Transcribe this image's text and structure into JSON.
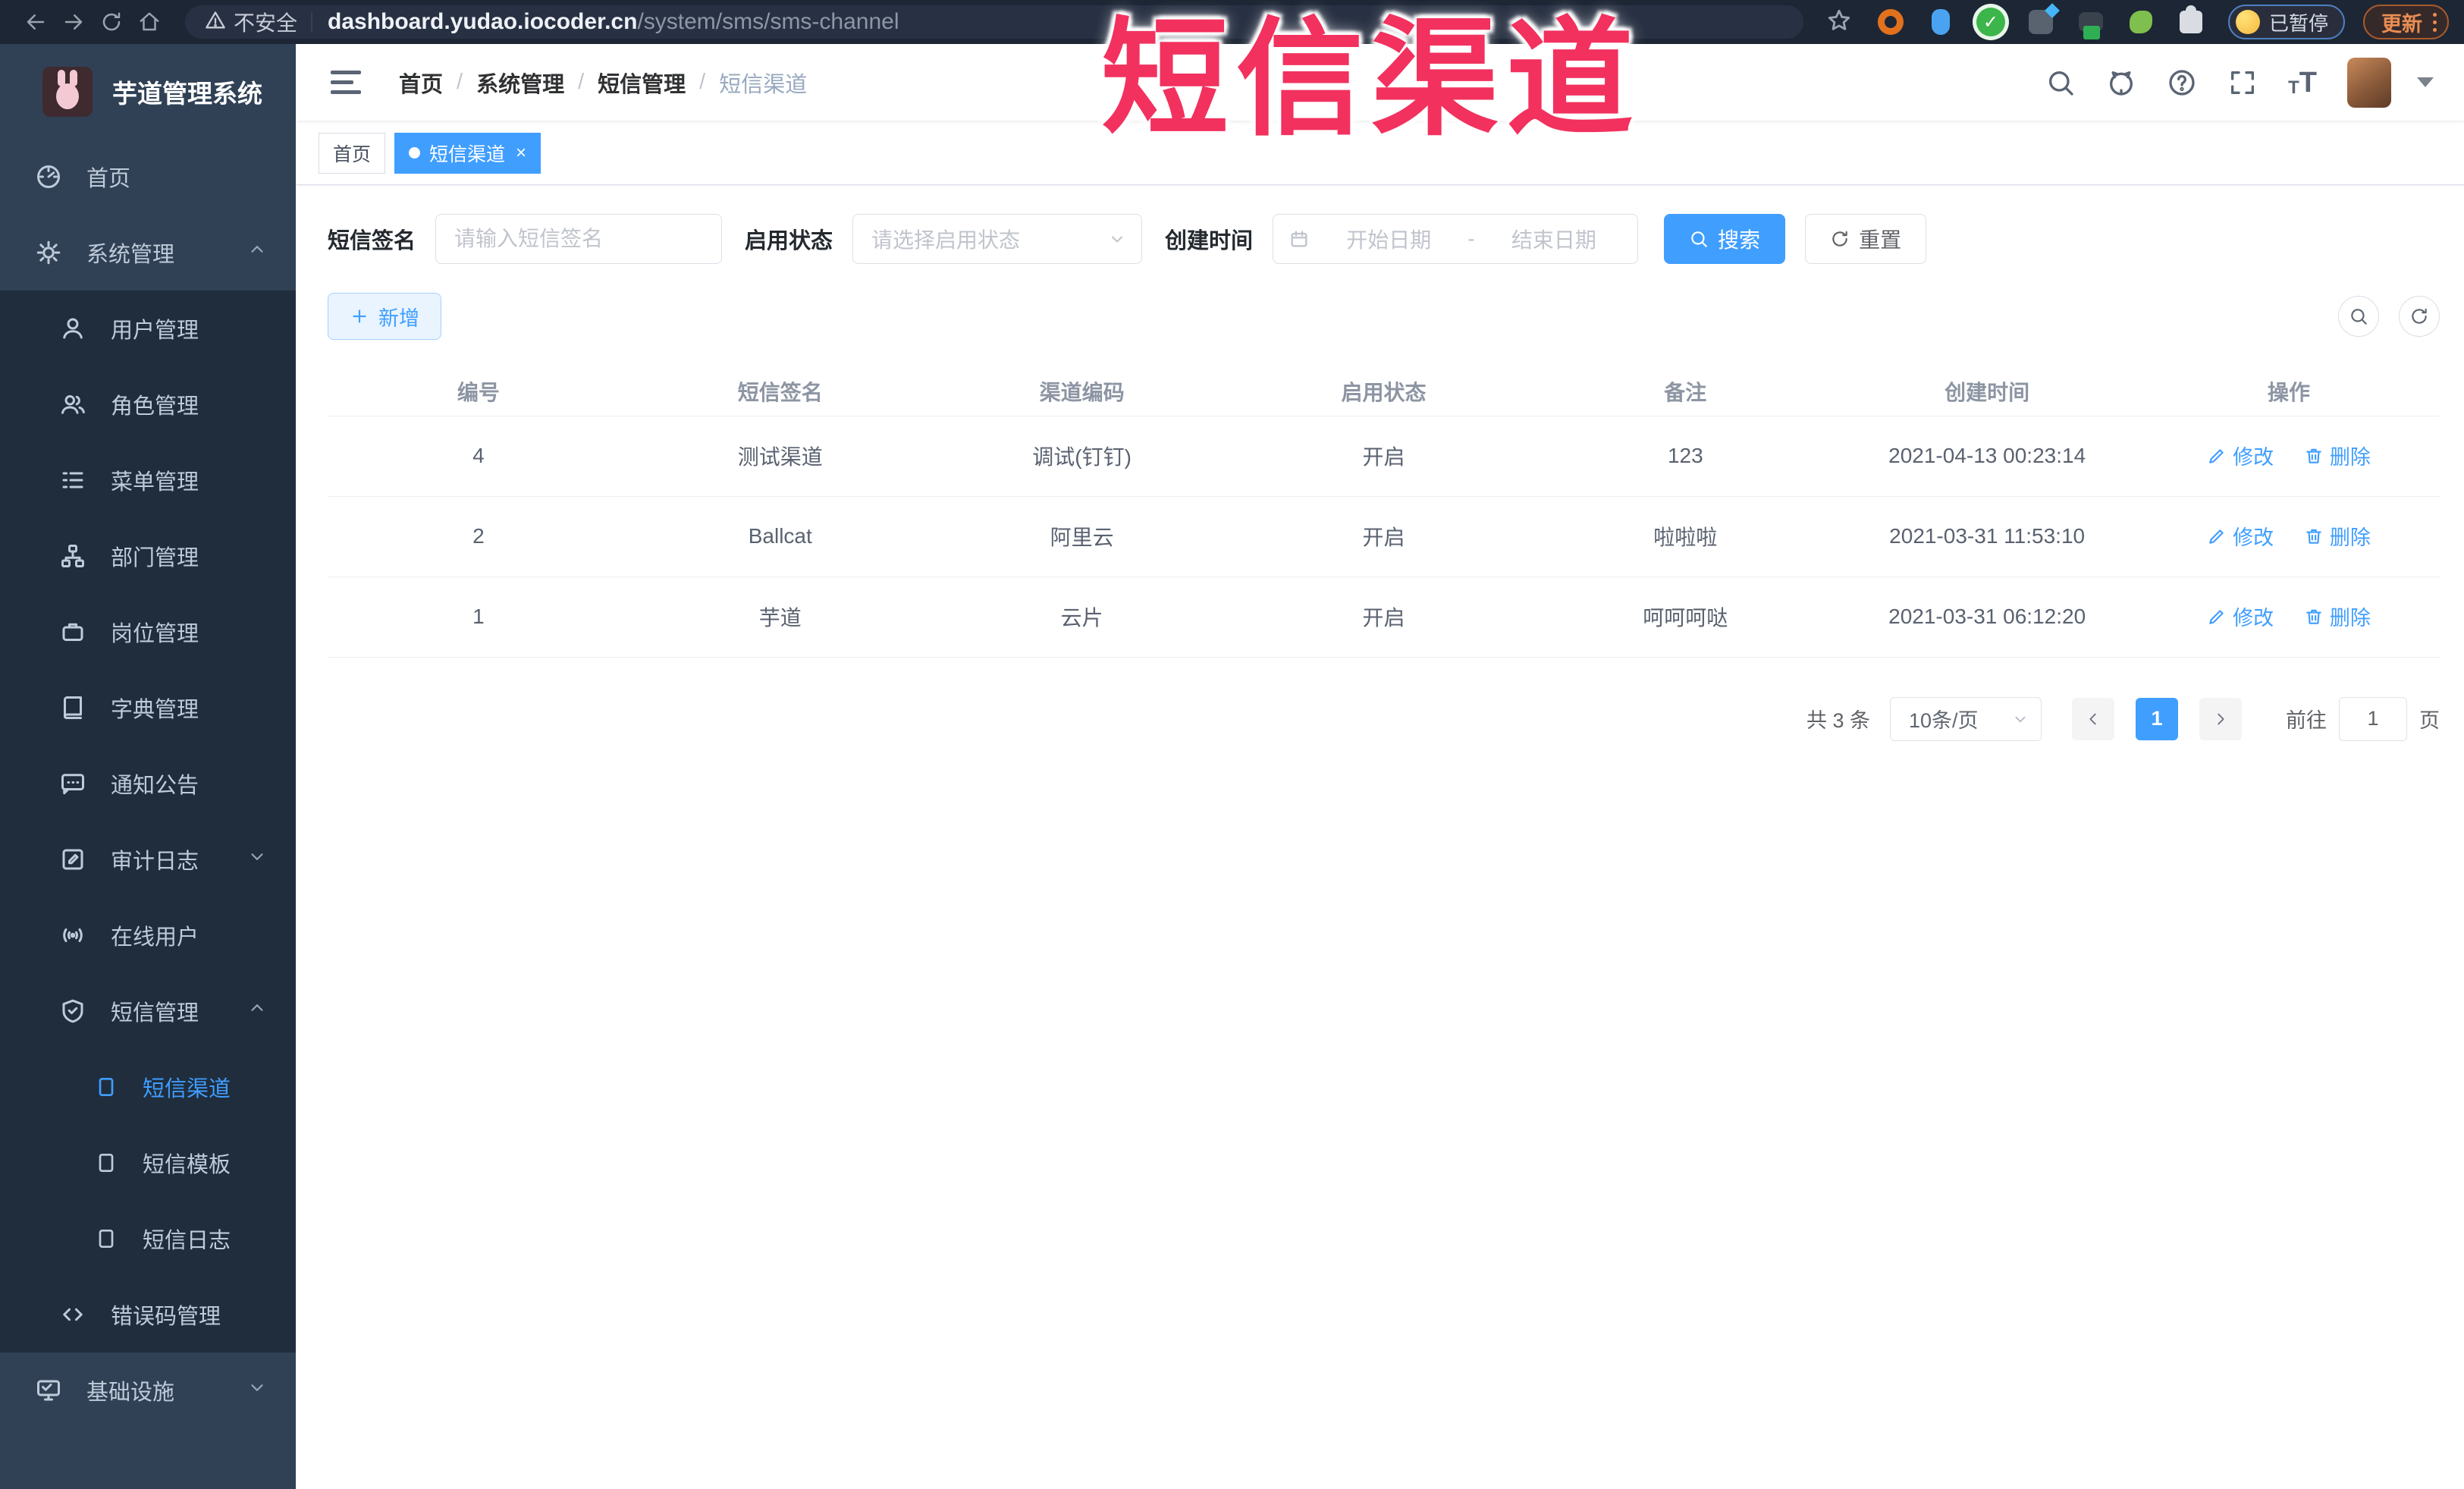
{
  "browser": {
    "security_label": "不安全",
    "url_host": "dashboard.yudao.iocoder.cn",
    "url_path": "/system/sms/sms-channel",
    "paused_badge": "已暂停",
    "update_button": "更新"
  },
  "annotation": {
    "text": "短信渠道"
  },
  "sidebar": {
    "logo_title": "芋道管理系统",
    "items": [
      {
        "label": "首页"
      },
      {
        "label": "系统管理"
      },
      {
        "label": "用户管理"
      },
      {
        "label": "角色管理"
      },
      {
        "label": "菜单管理"
      },
      {
        "label": "部门管理"
      },
      {
        "label": "岗位管理"
      },
      {
        "label": "字典管理"
      },
      {
        "label": "通知公告"
      },
      {
        "label": "审计日志"
      },
      {
        "label": "在线用户"
      },
      {
        "label": "短信管理"
      },
      {
        "label": "短信渠道"
      },
      {
        "label": "短信模板"
      },
      {
        "label": "短信日志"
      },
      {
        "label": "错误码管理"
      },
      {
        "label": "基础设施"
      }
    ]
  },
  "breadcrumb": {
    "items": [
      "首页",
      "系统管理",
      "短信管理",
      "短信渠道"
    ]
  },
  "tabs": [
    {
      "label": "首页"
    },
    {
      "label": "短信渠道"
    }
  ],
  "filters": {
    "signature_label": "短信签名",
    "signature_placeholder": "请输入短信签名",
    "status_label": "启用状态",
    "status_placeholder": "请选择启用状态",
    "created_label": "创建时间",
    "date_start_placeholder": "开始日期",
    "date_separator": "-",
    "date_end_placeholder": "结束日期",
    "search_button": "搜索",
    "reset_button": "重置"
  },
  "toolbar": {
    "add_button": "新增"
  },
  "table": {
    "columns": [
      "编号",
      "短信签名",
      "渠道编码",
      "启用状态",
      "备注",
      "创建时间",
      "操作"
    ],
    "rows": [
      {
        "id": "4",
        "signature": "测试渠道",
        "code": "调试(钉钉)",
        "status": "开启",
        "remark": "123",
        "created": "2021-04-13 00:23:14"
      },
      {
        "id": "2",
        "signature": "Ballcat",
        "code": "阿里云",
        "status": "开启",
        "remark": "啦啦啦",
        "created": "2021-03-31 11:53:10"
      },
      {
        "id": "1",
        "signature": "芋道",
        "code": "云片",
        "status": "开启",
        "remark": "呵呵呵哒",
        "created": "2021-03-31 06:12:20"
      }
    ],
    "edit_label": "修改",
    "delete_label": "删除"
  },
  "pagination": {
    "total": "共 3 条",
    "page_size": "10条/页",
    "current_page": "1",
    "goto_label": "前往",
    "goto_value": "1",
    "page_unit": "页"
  },
  "colors": {
    "accent": "#409eff",
    "annotation": "#f2315e",
    "sidebar_bg": "#304156",
    "sidebar_submenu_bg": "#1f2d3d",
    "chrome_bg": "#1d2634"
  }
}
